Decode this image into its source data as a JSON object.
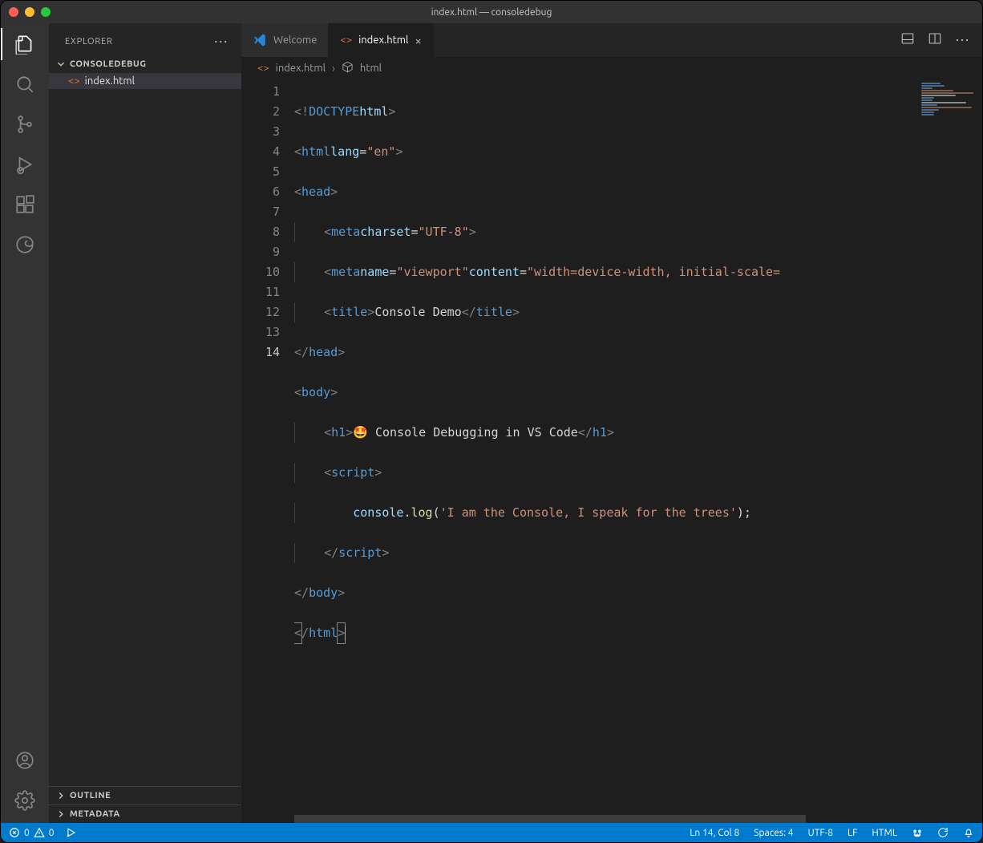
{
  "window": {
    "title": "index.html — consoledebug"
  },
  "sidebar": {
    "title": "EXPLORER",
    "folder": "CONSOLEDEBUG",
    "files": [
      {
        "name": "index.html"
      }
    ],
    "panels": [
      {
        "label": "OUTLINE"
      },
      {
        "label": "METADATA"
      }
    ]
  },
  "tabs": [
    {
      "label": "Welcome",
      "active": false
    },
    {
      "label": "index.html",
      "active": true
    }
  ],
  "breadcrumb": {
    "file": "index.html",
    "symbol": "html"
  },
  "editor": {
    "lineNumbers": [
      "1",
      "2",
      "3",
      "4",
      "5",
      "6",
      "7",
      "8",
      "9",
      "10",
      "11",
      "12",
      "13",
      "14"
    ],
    "currentLine": 14,
    "code": {
      "h1_emoji": "🤩",
      "h1_text": " Console Debugging in VS Code",
      "title_text": "Console Demo",
      "lang": "\"en\"",
      "charset": "\"UTF-8\"",
      "vp_name": "\"viewport\"",
      "vp_content": "\"width=device-width, initial-scale=",
      "log_str": "'I am the Console, I speak for the trees'"
    }
  },
  "status": {
    "errors": "0",
    "warnings": "0",
    "lncol": "Ln 14, Col 8",
    "spaces": "Spaces: 4",
    "encoding": "UTF-8",
    "eol": "LF",
    "lang": "HTML"
  }
}
